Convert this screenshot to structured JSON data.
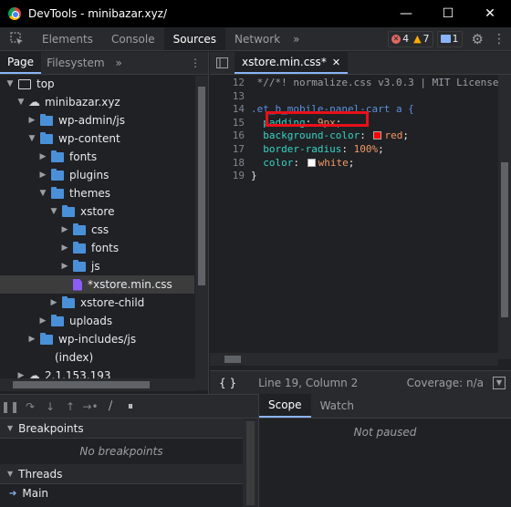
{
  "window": {
    "title": "DevTools - minibazar.xyz/",
    "minimize": "—",
    "maximize": "☐",
    "close": "✕"
  },
  "toolbar": {
    "tabs": [
      "Elements",
      "Console",
      "Sources",
      "Network"
    ],
    "active_tab": "Sources",
    "more": "»",
    "errors": "4",
    "warnings": "7",
    "messages": "1"
  },
  "navigator": {
    "tabs": [
      "Page",
      "Filesystem"
    ],
    "more": "»",
    "tree": [
      {
        "label": "top",
        "depth": 0,
        "type": "frame",
        "open": true
      },
      {
        "label": "minibazar.xyz",
        "depth": 1,
        "type": "cloud",
        "open": true
      },
      {
        "label": "wp-admin/js",
        "depth": 2,
        "type": "folder",
        "open": false
      },
      {
        "label": "wp-content",
        "depth": 2,
        "type": "folder",
        "open": true
      },
      {
        "label": "fonts",
        "depth": 3,
        "type": "folder",
        "open": false
      },
      {
        "label": "plugins",
        "depth": 3,
        "type": "folder",
        "open": false
      },
      {
        "label": "themes",
        "depth": 3,
        "type": "folder",
        "open": true
      },
      {
        "label": "xstore",
        "depth": 4,
        "type": "folder",
        "open": true
      },
      {
        "label": "css",
        "depth": 5,
        "type": "folder",
        "open": false
      },
      {
        "label": "fonts",
        "depth": 5,
        "type": "folder",
        "open": false
      },
      {
        "label": "js",
        "depth": 5,
        "type": "folder",
        "open": false
      },
      {
        "label": "*xstore.min.css",
        "depth": 5,
        "type": "file",
        "selected": true
      },
      {
        "label": "xstore-child",
        "depth": 4,
        "type": "folder",
        "open": false
      },
      {
        "label": "uploads",
        "depth": 3,
        "type": "folder",
        "open": false
      },
      {
        "label": "wp-includes/js",
        "depth": 2,
        "type": "folder",
        "open": false
      },
      {
        "label": "(index)",
        "depth": 2,
        "type": "doc"
      },
      {
        "label": "2.1.153.193",
        "depth": 1,
        "type": "cloud",
        "open": false
      }
    ]
  },
  "editor": {
    "tab_label": "xstore.min.css*",
    "tab_close": "✕",
    "lines": [
      {
        "num": "12",
        "kind": "comment",
        "text": " *//*! normalize.css v3.0.3 | MIT License"
      },
      {
        "num": "13",
        "kind": "blank",
        "text": ""
      },
      {
        "num": "14",
        "kind": "selector",
        "text": ".et_b_mobile-panel-cart a {"
      },
      {
        "num": "15",
        "kind": "decl",
        "prop": "padding",
        "value": "9px",
        "swatch": ""
      },
      {
        "num": "16",
        "kind": "decl",
        "prop": "background-color",
        "value": "red",
        "swatch": "#ff0000"
      },
      {
        "num": "17",
        "kind": "decl",
        "prop": "border-radius",
        "value": "100%",
        "swatch": ""
      },
      {
        "num": "18",
        "kind": "decl",
        "prop": "color",
        "value": "white",
        "swatch": "#ffffff"
      },
      {
        "num": "19",
        "kind": "close",
        "text": "}"
      }
    ],
    "highlight_color": "#e8101a"
  },
  "status": {
    "braces": "{ }",
    "position": "Line 19, Column 2",
    "coverage": "Coverage: n/a"
  },
  "debugger": {
    "breakpoints_title": "Breakpoints",
    "breakpoints_empty": "No breakpoints",
    "threads_title": "Threads",
    "thread_main": "Main"
  },
  "scope": {
    "tabs": [
      "Scope",
      "Watch"
    ],
    "status": "Not paused"
  },
  "colors": {
    "accent": "#8ab4f8",
    "error": "#e46962",
    "warning": "#f9ab00",
    "folder": "#4a90d9",
    "css_file": "#8b5cf6"
  }
}
